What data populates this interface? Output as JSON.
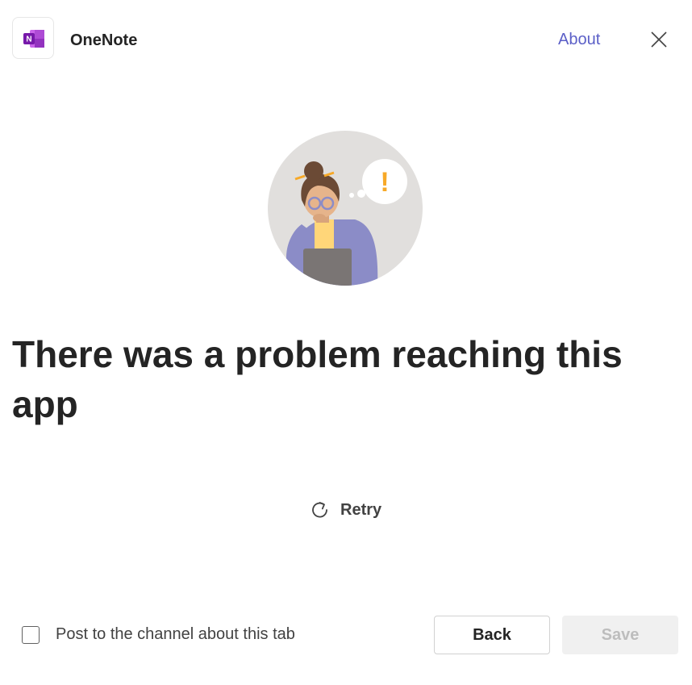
{
  "header": {
    "app_name": "OneNote",
    "about_label": "About",
    "logo_letter": "N",
    "logo_icon": "onenote-logo-icon",
    "close_icon": "close-icon"
  },
  "illustration": {
    "icon": "person-thinking-illustration",
    "alert_mark": "!"
  },
  "main": {
    "error_title": "There was a problem reaching this app",
    "retry_label": "Retry",
    "retry_icon": "refresh-icon"
  },
  "footer": {
    "checkbox_label": "Post to the channel about this tab",
    "checkbox_checked": false,
    "back_label": "Back",
    "save_label": "Save",
    "save_disabled": true
  },
  "colors": {
    "accent": "#5b5fc7",
    "onenote_purple": "#7719aa",
    "text": "#242424",
    "disabled_bg": "#f0f0f0",
    "disabled_text": "#bdbdbd"
  }
}
